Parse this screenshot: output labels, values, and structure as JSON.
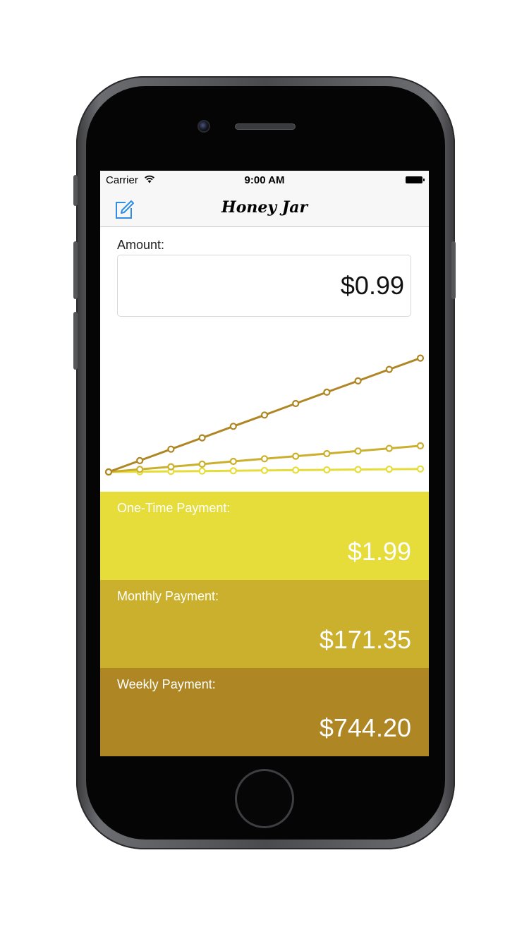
{
  "status_bar": {
    "carrier": "Carrier",
    "time": "9:00 AM",
    "wifi_icon": "wifi-icon",
    "battery_icon": "battery-icon"
  },
  "nav": {
    "title": "Honey Jar",
    "compose_icon": "compose-icon",
    "accent_color": "#2f8de4"
  },
  "amount": {
    "label": "Amount:",
    "value": "$0.99"
  },
  "chart_data": {
    "type": "line",
    "title": "",
    "xlabel": "",
    "ylabel": "",
    "x": [
      0,
      1,
      2,
      3,
      4,
      5,
      6,
      7,
      8,
      9,
      10
    ],
    "ylim": [
      0,
      1000
    ],
    "grid": false,
    "series": [
      {
        "color": "#e6dc3a",
        "values": [
          0,
          2,
          4,
          6,
          8,
          10,
          12,
          14,
          16,
          18,
          20
        ]
      },
      {
        "color": "#cbb02d",
        "values": [
          0,
          17,
          34,
          51,
          69,
          86,
          103,
          120,
          137,
          154,
          171
        ]
      },
      {
        "color": "#ae8724",
        "values": [
          0,
          74,
          149,
          223,
          298,
          372,
          447,
          521,
          595,
          670,
          744
        ]
      }
    ]
  },
  "payments": [
    {
      "label": "One-Time Payment:",
      "value": "$1.99",
      "color": "#e6dc3a"
    },
    {
      "label": "Monthly Payment:",
      "value": "$171.35",
      "color": "#cbb02d"
    },
    {
      "label": "Weekly Payment:",
      "value": "$744.20",
      "color": "#ae8724"
    }
  ]
}
